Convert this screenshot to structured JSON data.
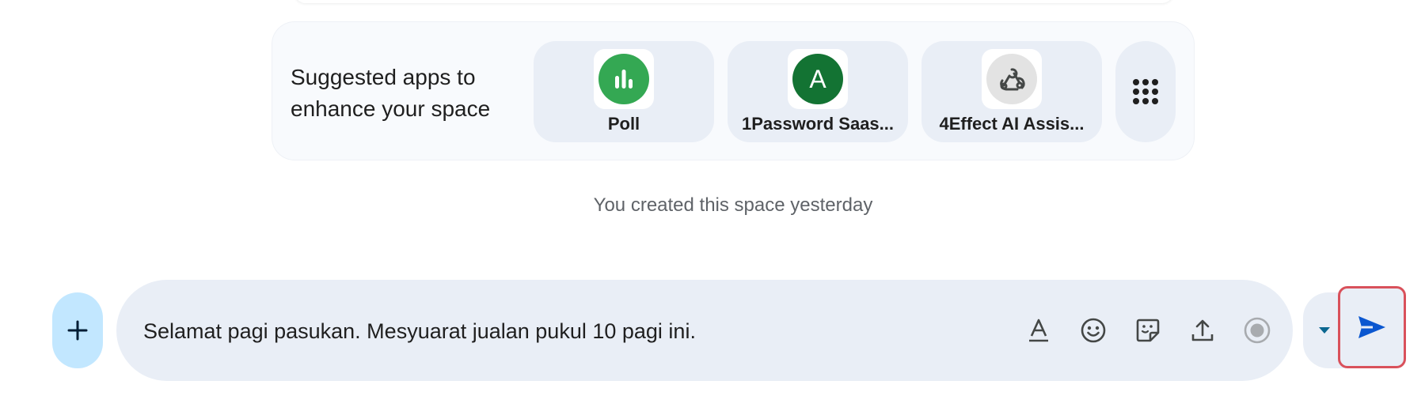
{
  "suggested_apps": {
    "heading": "Suggested apps to enhance your space",
    "apps": [
      {
        "name": "Poll",
        "icon": "poll-chart-icon",
        "color": "#34a853"
      },
      {
        "name": "1Password Saas...",
        "icon": "avatar-letter-icon",
        "letter": "A",
        "color": "#137333"
      },
      {
        "name": "4Effect AI Assis...",
        "icon": "webhook-icon",
        "color": "#e3e3e3"
      }
    ],
    "more_icon": "app-grid-icon"
  },
  "status": {
    "created_note": "You created this space yesterday"
  },
  "composer": {
    "add_icon": "plus-icon",
    "message_value": "Selamat pagi pasukan. Mesyuarat jualan pukul 10 pagi ini.",
    "tools": [
      "format-text-icon",
      "emoji-icon",
      "sticker-icon",
      "upload-icon",
      "record-icon"
    ],
    "send_options_icon": "caret-down-icon",
    "send_icon": "send-icon"
  },
  "colors": {
    "accent": "#0b57d0",
    "highlight": "#d9515b",
    "surface": "#e9eef6",
    "add_button": "#c2e7ff"
  }
}
